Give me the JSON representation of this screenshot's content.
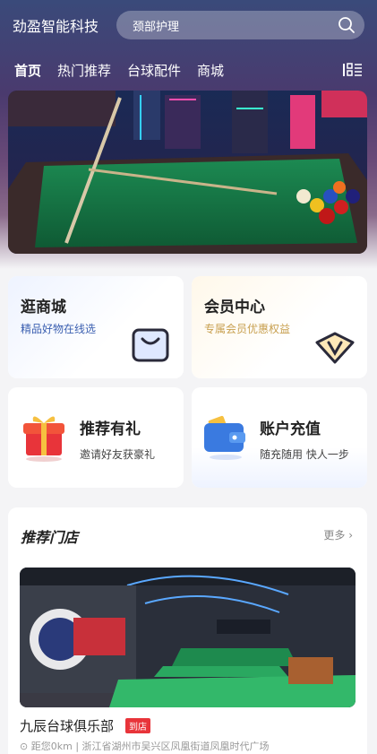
{
  "header": {
    "brand": "劲盈智能科技",
    "search_placeholder": "颈部护理"
  },
  "nav": {
    "tabs": [
      "首页",
      "热门推荐",
      "台球配件",
      "商城"
    ]
  },
  "cards": {
    "mall": {
      "title": "逛商城",
      "subtitle": "精品好物在线选"
    },
    "member": {
      "title": "会员中心",
      "subtitle": "专属会员优惠权益"
    },
    "recommend": {
      "title": "推荐有礼",
      "subtitle": "邀请好友获豪礼"
    },
    "recharge": {
      "title": "账户充值",
      "subtitle": "随充随用 快人一步"
    }
  },
  "stores": {
    "title": "推荐门店",
    "more": "更多",
    "item": {
      "name": "九辰台球俱乐部",
      "badge": "到店",
      "distance": "距您0km",
      "address": "浙江省湖州市吴兴区凤凰街道凤凰时代广场"
    }
  },
  "colors": {
    "accent": "#e8343a",
    "member_gold": "#c8a050",
    "mall_blue": "#3b5fb0"
  }
}
